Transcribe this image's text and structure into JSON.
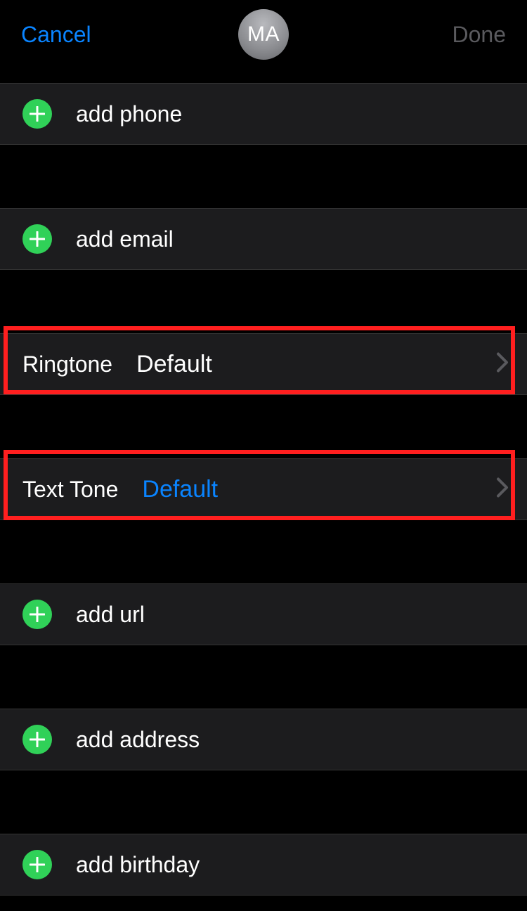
{
  "header": {
    "cancel": "Cancel",
    "done": "Done",
    "avatar_initials": "MA"
  },
  "rows": {
    "add_phone": "add phone",
    "add_email": "add email",
    "add_url": "add url",
    "add_address": "add address",
    "add_birthday": "add birthday"
  },
  "settings": {
    "ringtone_label": "Ringtone",
    "ringtone_value": "Default",
    "texttone_label": "Text Tone",
    "texttone_value": "Default"
  }
}
